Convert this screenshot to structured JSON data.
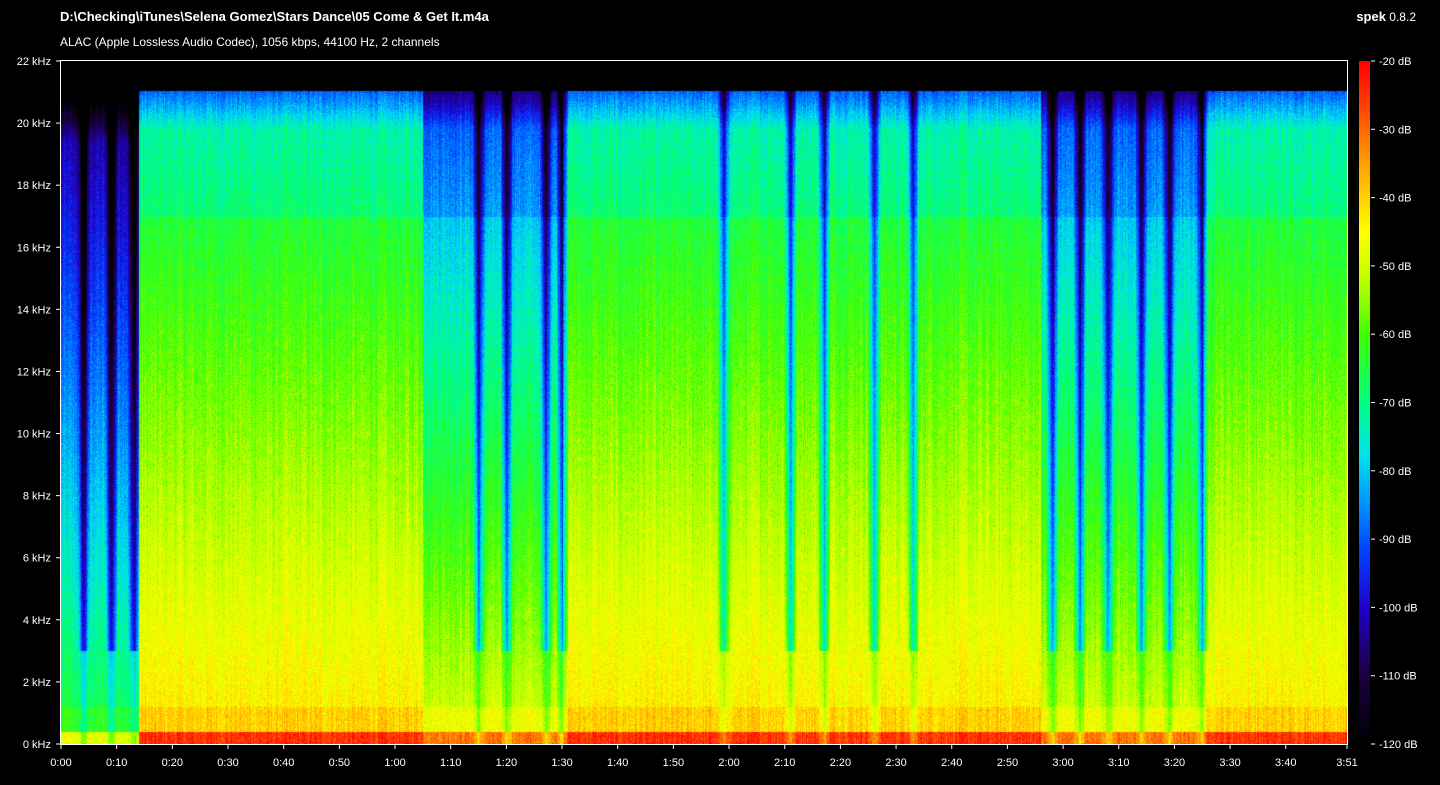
{
  "window": {
    "file_path": "D:\\Checking\\iTunes\\Selena Gomez\\Stars Dance\\05 Come & Get It.m4a",
    "codec_info": "ALAC (Apple Lossless Audio Codec), 1056 kbps, 44100 Hz, 2 channels",
    "app_name": "spek",
    "app_version": "0.8.2"
  },
  "chart_data": {
    "type": "heatmap",
    "title": "D:\\Checking\\iTunes\\Selena Gomez\\Stars Dance\\05 Come & Get It.m4a",
    "subtitle": "ALAC (Apple Lossless Audio Codec), 1056 kbps, 44100 Hz, 2 channels",
    "x_unit": "time",
    "x_range_seconds": [
      0,
      231
    ],
    "x_ticks": [
      "0:00",
      "0:10",
      "0:20",
      "0:30",
      "0:40",
      "0:50",
      "1:00",
      "1:10",
      "1:20",
      "1:30",
      "1:40",
      "1:50",
      "2:00",
      "2:10",
      "2:20",
      "2:30",
      "2:40",
      "2:50",
      "3:00",
      "3:10",
      "3:20",
      "3:30",
      "3:40",
      "3:51"
    ],
    "x_tick_seconds": [
      0,
      10,
      20,
      30,
      40,
      50,
      60,
      70,
      80,
      90,
      100,
      110,
      120,
      130,
      140,
      150,
      160,
      170,
      180,
      190,
      200,
      210,
      220,
      231
    ],
    "y_unit": "kHz",
    "y_range": [
      0,
      22
    ],
    "y_ticks": [
      "0 kHz",
      "2 kHz",
      "4 kHz",
      "6 kHz",
      "8 kHz",
      "10 kHz",
      "12 kHz",
      "14 kHz",
      "16 kHz",
      "18 kHz",
      "20 kHz",
      "22 kHz"
    ],
    "y_tick_values": [
      0,
      2,
      4,
      6,
      8,
      10,
      12,
      14,
      16,
      18,
      20,
      22
    ],
    "colorbar_unit": "dB",
    "colorbar_range": [
      -120,
      -20
    ],
    "colorbar_ticks": [
      "-20 dB",
      "-30 dB",
      "-40 dB",
      "-50 dB",
      "-60 dB",
      "-70 dB",
      "-80 dB",
      "-90 dB",
      "-100 dB",
      "-110 dB",
      "-120 dB"
    ],
    "colorbar_values": [
      -20,
      -30,
      -40,
      -50,
      -60,
      -70,
      -80,
      -90,
      -100,
      -110,
      -120
    ],
    "colormap": [
      {
        "db": -120,
        "color": "#000000"
      },
      {
        "db": -110,
        "color": "#1a0040"
      },
      {
        "db": -100,
        "color": "#2000c8"
      },
      {
        "db": -92,
        "color": "#0040ff"
      },
      {
        "db": -85,
        "color": "#0090ff"
      },
      {
        "db": -78,
        "color": "#00e0f0"
      },
      {
        "db": -70,
        "color": "#00ff80"
      },
      {
        "db": -60,
        "color": "#40ff00"
      },
      {
        "db": -52,
        "color": "#c0ff00"
      },
      {
        "db": -45,
        "color": "#ffff00"
      },
      {
        "db": -35,
        "color": "#ffa000"
      },
      {
        "db": -25,
        "color": "#ff3000"
      },
      {
        "db": -20,
        "color": "#ff0000"
      }
    ],
    "frequency_cutoff_khz": 21,
    "sections": [
      {
        "start_s": 0,
        "end_s": 14,
        "level": "quiet intro",
        "upper_khz": 20.6
      },
      {
        "start_s": 14.5,
        "end_s": 65,
        "level": "full",
        "upper_khz": 21
      },
      {
        "start_s": 65,
        "end_s": 90,
        "level": "mixed",
        "upper_khz": 21
      },
      {
        "start_s": 90.5,
        "end_s": 154.5,
        "level": "full",
        "upper_khz": 21
      },
      {
        "start_s": 155,
        "end_s": 176,
        "level": "full",
        "upper_khz": 21
      },
      {
        "start_s": 176,
        "end_s": 205,
        "level": "mixed",
        "upper_khz": 21
      },
      {
        "start_s": 205,
        "end_s": 231,
        "level": "full",
        "upper_khz": 21
      }
    ],
    "dips_seconds": [
      4,
      9,
      13,
      75,
      80,
      87,
      90,
      119,
      131,
      137,
      146,
      153,
      178,
      183,
      188,
      194,
      199,
      205
    ]
  }
}
